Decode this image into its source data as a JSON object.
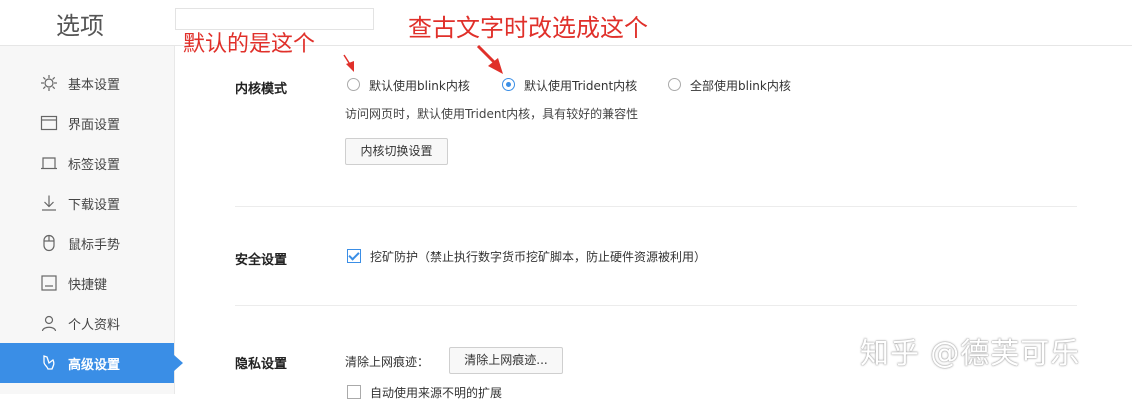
{
  "window": {
    "title": "选项"
  },
  "sidebar": {
    "items": [
      {
        "label": "基本设置",
        "icon": "gear-icon",
        "active": false
      },
      {
        "label": "界面设置",
        "icon": "window-icon",
        "active": false
      },
      {
        "label": "标签设置",
        "icon": "tab-icon",
        "active": false
      },
      {
        "label": "下载设置",
        "icon": "download-icon",
        "active": false
      },
      {
        "label": "鼠标手势",
        "icon": "mouse-icon",
        "active": false
      },
      {
        "label": "快捷键",
        "icon": "keyboard-icon",
        "active": false
      },
      {
        "label": "个人资料",
        "icon": "person-icon",
        "active": false
      },
      {
        "label": "高级设置",
        "icon": "advanced-icon",
        "active": true
      }
    ]
  },
  "kernel": {
    "label": "内核模式",
    "options": [
      {
        "label": "默认使用blink内核",
        "checked": false
      },
      {
        "label": "默认使用Trident内核",
        "checked": true
      },
      {
        "label": "全部使用blink内核",
        "checked": false
      }
    ],
    "note": "访问网页时，默认使用Trident内核，具有较好的兼容性",
    "switch_button": "内核切换设置"
  },
  "security": {
    "label": "安全设置",
    "mining_protection": {
      "label": "挖矿防护（禁止执行数字货币挖矿脚本，防止硬件资源被利用）",
      "checked": true
    }
  },
  "privacy": {
    "label": "隐私设置",
    "clear_label": "清除上网痕迹：",
    "clear_button": "清除上网痕迹...",
    "partial_option": "自动使用来源不明的扩展"
  },
  "annotations": {
    "left": "默认的是这个",
    "right": "查古文字时改选成这个",
    "color": "#e0302a"
  },
  "watermark": "知乎 @德芙可乐",
  "colors": {
    "accent": "#3a8ee6"
  }
}
